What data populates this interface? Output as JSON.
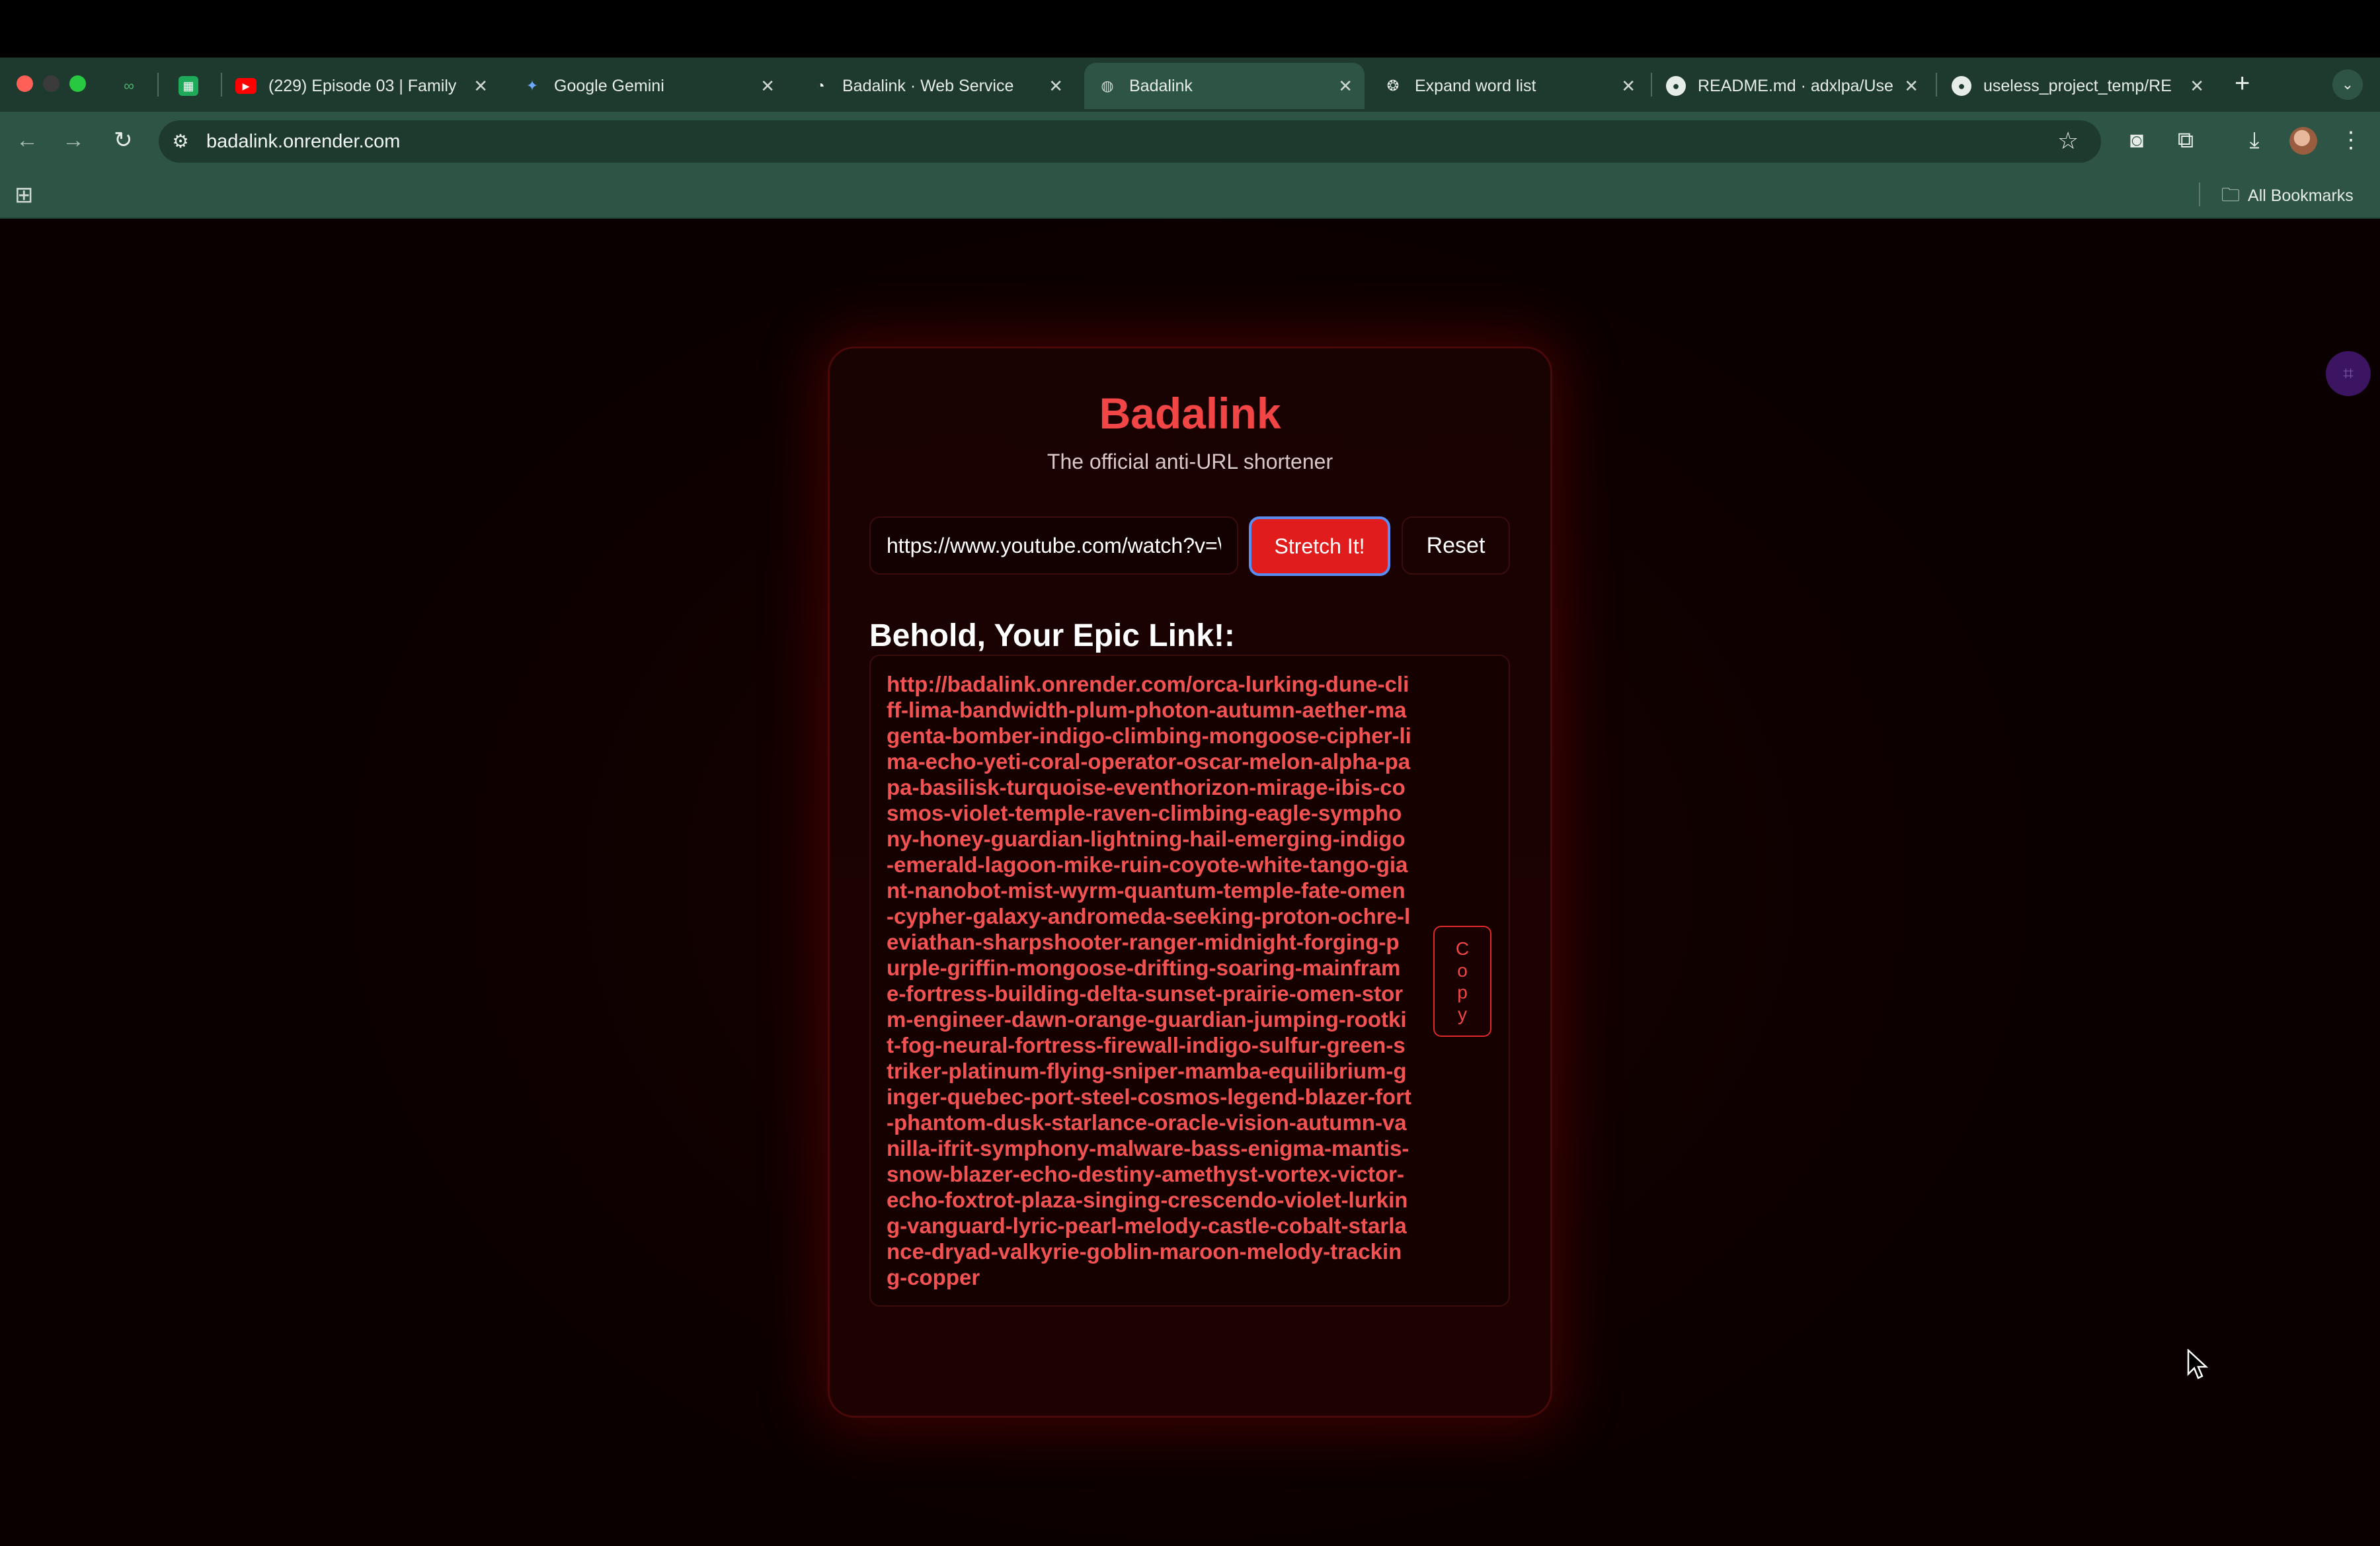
{
  "browser": {
    "tabs": [
      {
        "title": "",
        "favicon": "link-icon",
        "active": false
      },
      {
        "title": "",
        "favicon": "sheets-icon",
        "active": false
      },
      {
        "title": "(229) Episode 03 | Family",
        "favicon": "youtube-icon",
        "active": false
      },
      {
        "title": "Google Gemini",
        "favicon": "gemini-icon",
        "active": false
      },
      {
        "title": "Badalink · Web Service",
        "favicon": "render-icon",
        "active": false
      },
      {
        "title": "Badalink",
        "favicon": "globe-icon",
        "active": true
      },
      {
        "title": "Expand word list",
        "favicon": "openai-icon",
        "active": false
      },
      {
        "title": "README.md · adxlpa/Use",
        "favicon": "github-icon",
        "active": false
      },
      {
        "title": "useless_project_temp/RE",
        "favicon": "github-icon",
        "active": false
      }
    ],
    "close_glyph": "✕",
    "new_tab_glyph": "+",
    "address": "badalink.onrender.com",
    "bookmarks_label": "All Bookmarks"
  },
  "app": {
    "title": "Badalink",
    "tagline": "The official anti-URL shortener",
    "input_value": "https://www.youtube.com/watch?v=\\",
    "stretch_label": "Stretch It!",
    "reset_label": "Reset",
    "result_heading": "Behold, Your Epic Link!:",
    "result_link": "http://badalink.onrender.com/orca-lurking-dune-cliff-lima-bandwidth-plum-photon-autumn-aether-magenta-bomber-indigo-climbing-mongoose-cipher-lima-echo-yeti-coral-operator-oscar-melon-alpha-papa-basilisk-turquoise-eventhorizon-mirage-ibis-cosmos-violet-temple-raven-climbing-eagle-symphony-honey-guardian-lightning-hail-emerging-indigo-emerald-lagoon-mike-ruin-coyote-white-tango-giant-nanobot-mist-wyrm-quantum-temple-fate-omen-cypher-galaxy-andromeda-seeking-proton-ochre-leviathan-sharpshooter-ranger-midnight-forging-purple-griffin-mongoose-drifting-soaring-mainframe-fortress-building-delta-sunset-prairie-omen-storm-engineer-dawn-orange-guardian-jumping-rootkit-fog-neural-fortress-firewall-indigo-sulfur-green-striker-platinum-flying-sniper-mamba-equilibrium-ginger-quebec-port-steel-cosmos-legend-blazer-fort-phantom-dusk-starlance-oracle-vision-autumn-vanilla-ifrit-symphony-malware-bass-enigma-mantis-snow-blazer-echo-destiny-amethyst-vortex-victor-echo-foxtrot-plaza-singing-crescendo-violet-lurking-vanguard-lyric-pearl-melody-castle-cobalt-starlance-dryad-valkyrie-goblin-maroon-melody-tracking-copper",
    "copy_label": "Copy"
  },
  "colors": {
    "accent": "#f24545",
    "button_red": "#e01c1c",
    "tab_strip": "#1e3a2f",
    "toolbar": "#2d5444"
  }
}
